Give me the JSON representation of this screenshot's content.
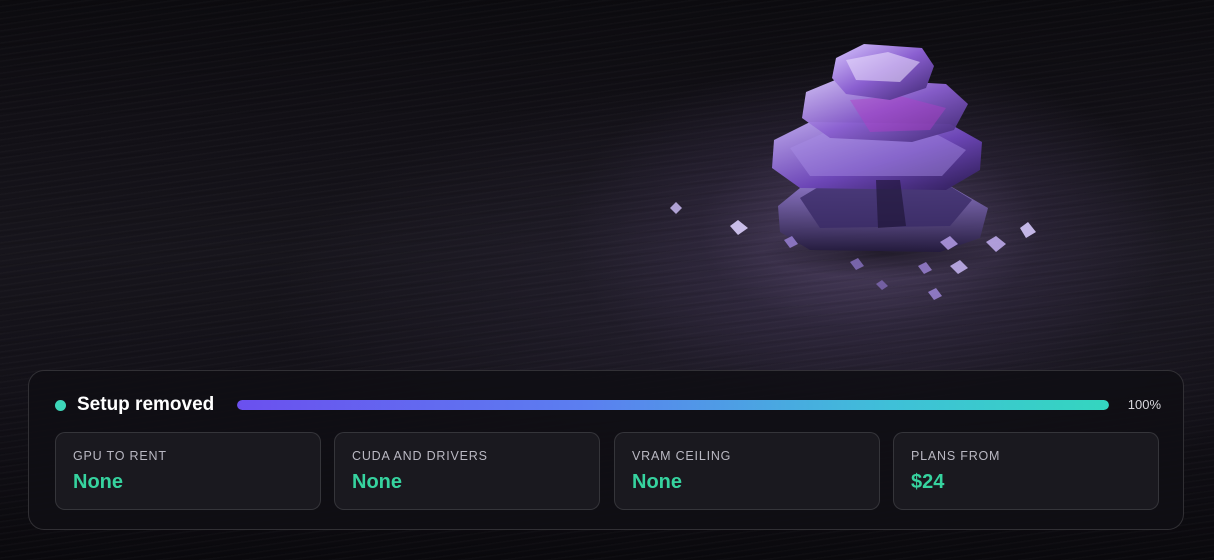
{
  "status": {
    "label": "Setup removed",
    "progress_text": "100%",
    "progress_value": 1.0,
    "dot_color": "#3dd6b9"
  },
  "stats": [
    {
      "label": "GPU TO RENT",
      "value": "None"
    },
    {
      "label": "CUDA AND DRIVERS",
      "value": "None"
    },
    {
      "label": "VRAM CEILING",
      "value": "None"
    },
    {
      "label": "PLANS FROM",
      "value": "$24"
    }
  ],
  "colors": {
    "accent_value": "#36d39f",
    "progress_start": "#6b50ef",
    "progress_end": "#34d6bf"
  },
  "background_image": "amethyst-crystal-stack-photo"
}
